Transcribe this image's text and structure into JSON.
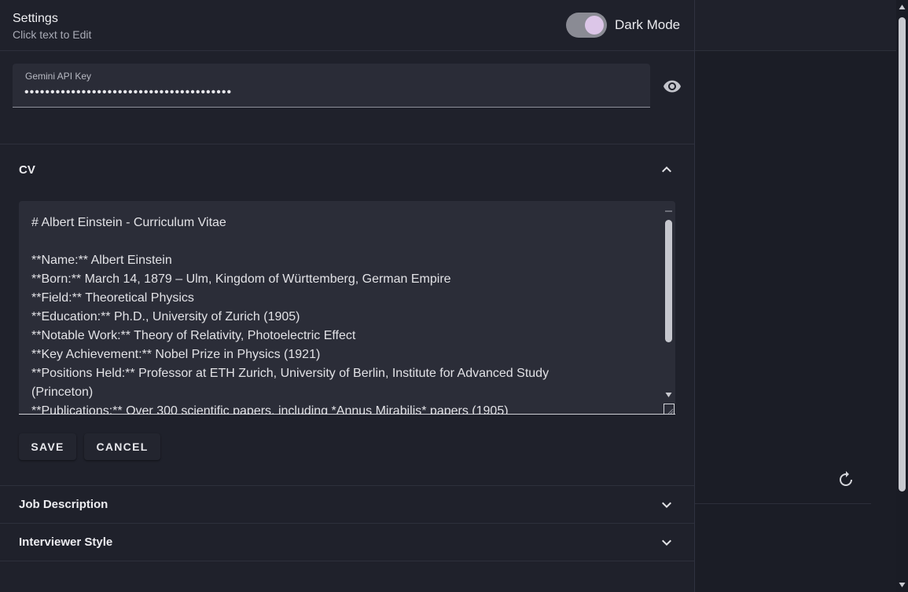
{
  "drawer": {
    "title": "Settings",
    "subtitle": "Click text to Edit",
    "dark_mode_label": "Dark Mode",
    "dark_mode_enabled": true
  },
  "api_key": {
    "label": "Gemini API Key",
    "masked_value": "••••••••••••••••••••••••••••••••••••••••"
  },
  "cv": {
    "title": "CV",
    "expanded": true,
    "lines": [
      "# Albert Einstein - Curriculum Vitae",
      "",
      "**Name:** Albert Einstein",
      "**Born:** March 14, 1879 – Ulm, Kingdom of Württemberg, German Empire",
      "**Field:** Theoretical Physics",
      "**Education:** Ph.D., University of Zurich (1905)",
      "**Notable Work:** Theory of Relativity, Photoelectric Effect",
      "**Key Achievement:** Nobel Prize in Physics (1921)",
      "**Positions Held:** Professor at ETH Zurich, University of Berlin, Institute for Advanced Study",
      "(Princeton)",
      "**Publications:** Over 300 scientific papers, including *Annus Mirabilis* papers (1905)"
    ],
    "save_label": "SAVE",
    "cancel_label": "CANCEL"
  },
  "sections": {
    "job_description": "Job Description",
    "interviewer_style": "Interviewer Style"
  },
  "icons": {
    "visibility": "eye-icon",
    "expand_less": "chevron-up-icon",
    "expand_more": "chevron-down-icon",
    "reset": "refresh-icon"
  },
  "colors": {
    "background": "#1f212b",
    "toggle_knob": "#dcc6e8",
    "field_background": "#2a2c37"
  }
}
